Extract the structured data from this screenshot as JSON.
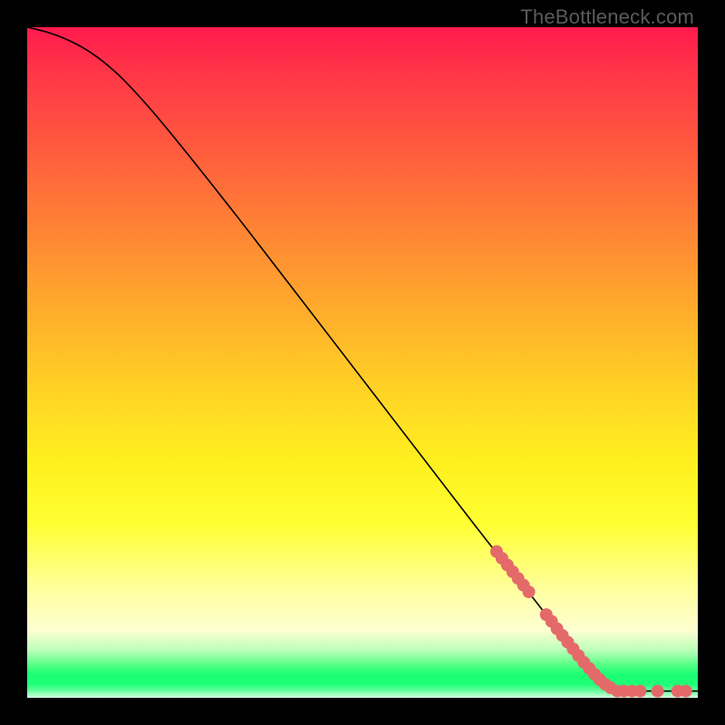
{
  "watermark": "TheBottleneck.com",
  "chart_data": {
    "type": "line",
    "title": "",
    "xlabel": "",
    "ylabel": "",
    "xlim": [
      0,
      100
    ],
    "ylim": [
      0,
      100
    ],
    "curve": [
      {
        "x": 0,
        "y": 100
      },
      {
        "x": 3,
        "y": 99.3
      },
      {
        "x": 6,
        "y": 98.2
      },
      {
        "x": 9,
        "y": 96.6
      },
      {
        "x": 12,
        "y": 94.4
      },
      {
        "x": 15,
        "y": 91.6
      },
      {
        "x": 20,
        "y": 86.0
      },
      {
        "x": 30,
        "y": 73.5
      },
      {
        "x": 40,
        "y": 60.5
      },
      {
        "x": 50,
        "y": 47.5
      },
      {
        "x": 60,
        "y": 34.5
      },
      {
        "x": 70,
        "y": 21.5
      },
      {
        "x": 75,
        "y": 15.5
      },
      {
        "x": 80,
        "y": 9.0
      },
      {
        "x": 84,
        "y": 4.2
      },
      {
        "x": 86.5,
        "y": 1.8
      },
      {
        "x": 88,
        "y": 1.0
      },
      {
        "x": 100,
        "y": 1.0
      }
    ],
    "markers": [
      {
        "x": 70.0,
        "y": 21.8
      },
      {
        "x": 70.8,
        "y": 20.8
      },
      {
        "x": 71.6,
        "y": 19.8
      },
      {
        "x": 72.4,
        "y": 18.8
      },
      {
        "x": 73.2,
        "y": 17.8
      },
      {
        "x": 74.0,
        "y": 16.8
      },
      {
        "x": 74.8,
        "y": 15.8
      },
      {
        "x": 77.4,
        "y": 12.4
      },
      {
        "x": 78.2,
        "y": 11.4
      },
      {
        "x": 79.0,
        "y": 10.3
      },
      {
        "x": 79.8,
        "y": 9.3
      },
      {
        "x": 80.6,
        "y": 8.3
      },
      {
        "x": 81.4,
        "y": 7.3
      },
      {
        "x": 82.2,
        "y": 6.3
      },
      {
        "x": 83.0,
        "y": 5.3
      },
      {
        "x": 83.8,
        "y": 4.4
      },
      {
        "x": 84.6,
        "y": 3.5
      },
      {
        "x": 85.4,
        "y": 2.7
      },
      {
        "x": 86.2,
        "y": 2.0
      },
      {
        "x": 87.0,
        "y": 1.5
      },
      {
        "x": 88.0,
        "y": 1.0
      },
      {
        "x": 89.0,
        "y": 1.0
      },
      {
        "x": 90.2,
        "y": 1.0
      },
      {
        "x": 91.4,
        "y": 1.0
      },
      {
        "x": 94.0,
        "y": 1.0
      },
      {
        "x": 97.0,
        "y": 1.0
      },
      {
        "x": 98.2,
        "y": 1.0
      }
    ],
    "marker_color": "#e46a6a",
    "marker_radius_px": 7
  }
}
